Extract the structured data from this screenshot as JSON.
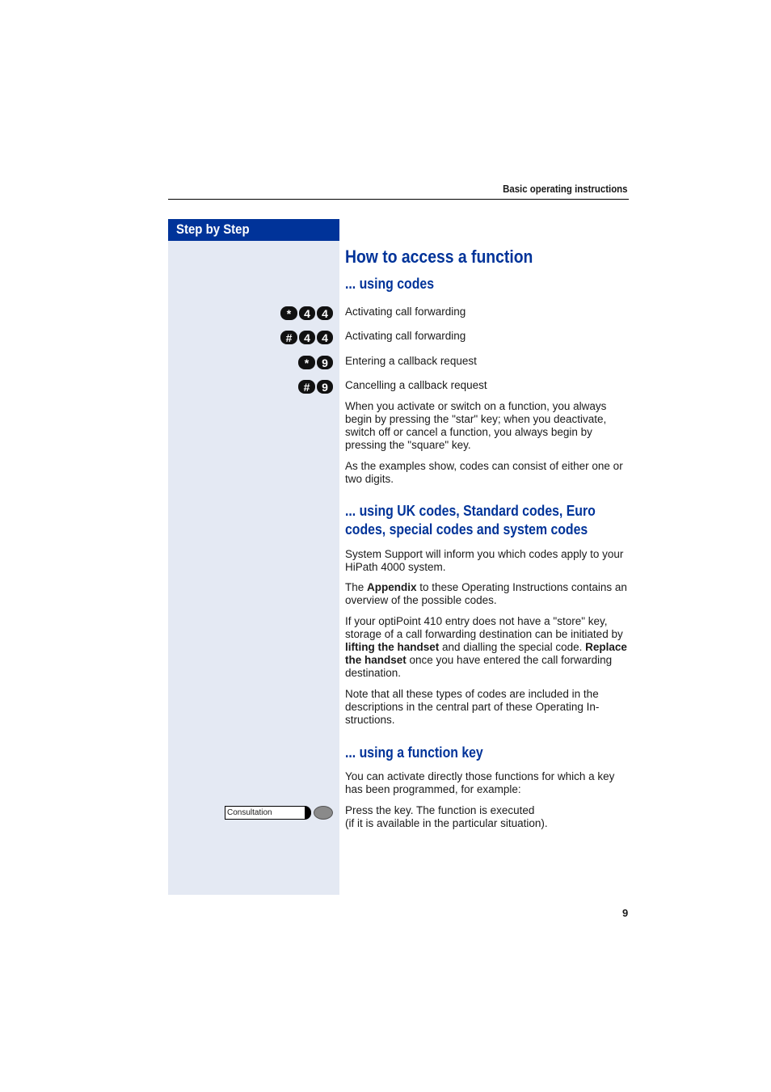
{
  "header": {
    "title": "Basic operating instructions"
  },
  "sidebar": {
    "heading": "Step by Step"
  },
  "main": {
    "title": "How to access a function",
    "section_codes": {
      "heading": "... using codes",
      "codes": [
        {
          "keys": [
            "*",
            "4",
            "4"
          ],
          "description": "Activating call forwarding"
        },
        {
          "keys": [
            "#",
            "4",
            "4"
          ],
          "description": "Activating call forwarding"
        },
        {
          "keys": [
            "*",
            "9"
          ],
          "description": "Entering a callback request"
        },
        {
          "keys": [
            "#",
            "9"
          ],
          "description": "Cancelling a callback request"
        }
      ],
      "para1": "When you activate or switch on a function, you always begin by pressing the \"star\" key; when you deactivate, switch off or cancel a function, you always begin by pressing the \"square\" key.",
      "para2": "As the examples show, codes can consist of either one or two digits."
    },
    "section_uk": {
      "heading_line1": "... using UK codes, Standard codes, Euro",
      "heading_line2": "codes, special codes and system codes",
      "para1": "System Support will inform you which codes apply to your HiPath 4000 system.",
      "para2_pre": "The ",
      "para2_bold": "Appendix",
      "para2_post": " to these Operating Instructions contains an overview of the possible codes.",
      "para3_a": "If your optiPoint 410 entry does not have a \"store\" key, storage of a call forwarding destination can be initiated by ",
      "para3_bold1": "lifting the handset",
      "para3_b": " and dialling the special code. ",
      "para3_bold2": "Replace the handset",
      "para3_c": " once you have entered the call forwarding destination.",
      "para4": "Note that all these types of codes are included in the descriptions in the central part of these Operating In-structions."
    },
    "section_fkey": {
      "heading": "... using a function key",
      "para1": "You can activate directly those functions for which a key has been programmed, for example:",
      "key_label": "Consultation",
      "step_line1": "Press the key. The function is executed",
      "step_line2": "(if it is available in the particular situation)."
    }
  },
  "footer": {
    "page_number": "9"
  }
}
